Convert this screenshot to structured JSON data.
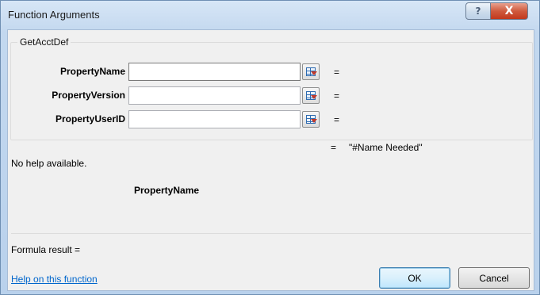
{
  "window": {
    "title": "Function Arguments",
    "help_glyph": "?",
    "close_glyph": "X"
  },
  "function_group": {
    "name": "GetAcctDef",
    "arguments": [
      {
        "label": "PropertyName",
        "value": "",
        "equals": "="
      },
      {
        "label": "PropertyVersion",
        "value": "",
        "equals": "="
      },
      {
        "label": "PropertyUserID",
        "value": "",
        "equals": "="
      }
    ]
  },
  "result": {
    "equals": "=",
    "value": "\"#Name Needed\""
  },
  "help_text": "No help available.",
  "current_param": "PropertyName",
  "formula_result": "Formula result =",
  "help_link": "Help on this function",
  "buttons": {
    "ok": "OK",
    "cancel": "Cancel"
  }
}
